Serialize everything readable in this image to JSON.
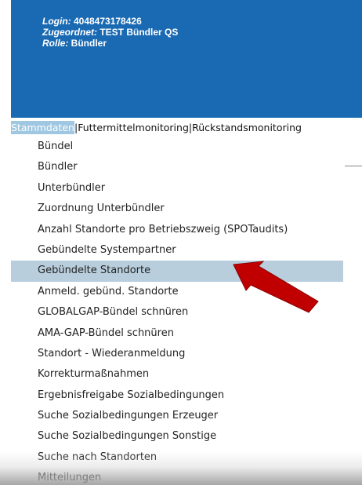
{
  "user": {
    "login_label": "Login:",
    "login_value": " 4048473178426",
    "assigned_label": "Zugeordnet:",
    "assigned_value": " TEST Bündler QS",
    "role_label": "Rolle:",
    "role_value": " Bündler"
  },
  "tabs": [
    {
      "label": "Stammdaten"
    },
    {
      "label": "Futtermittelmonitoring"
    },
    {
      "label": "Rückstandsmonitoring"
    }
  ],
  "tab_separator": "|",
  "menu": {
    "items": [
      {
        "label": "Bündel"
      },
      {
        "label": "Bündler"
      },
      {
        "label": "Unterbündler"
      },
      {
        "label": "Zuordnung Unterbündler"
      },
      {
        "label": "Anzahl Standorte pro Betriebszweig (SPOTaudits)"
      },
      {
        "label": "Gebündelte Systempartner"
      },
      {
        "label": "Gebündelte Standorte"
      },
      {
        "label": "Anmeld. gebünd. Standorte"
      },
      {
        "label": "GLOBALGAP-Bündel schnüren"
      },
      {
        "label": "AMA-GAP-Bündel schnüren"
      },
      {
        "label": "Standort - Wiederanmeldung"
      },
      {
        "label": "Korrekturmaßnahmen"
      },
      {
        "label": "Ergebnisfreigabe Sozialbedingungen"
      },
      {
        "label": "Suche Sozialbedingungen Erzeuger"
      },
      {
        "label": "Suche Sozialbedingungen Sonstige"
      },
      {
        "label": "Suche nach Standorten"
      },
      {
        "label": "Mitteilungen"
      }
    ],
    "active_index": 6
  },
  "colors": {
    "header_bg": "#1a6ab3",
    "active_tab_bg": "#9fc7e2",
    "active_item_bg": "#b9cedd",
    "arrow": "#c00000"
  },
  "icons": {
    "annotation": "red-arrow-icon"
  }
}
